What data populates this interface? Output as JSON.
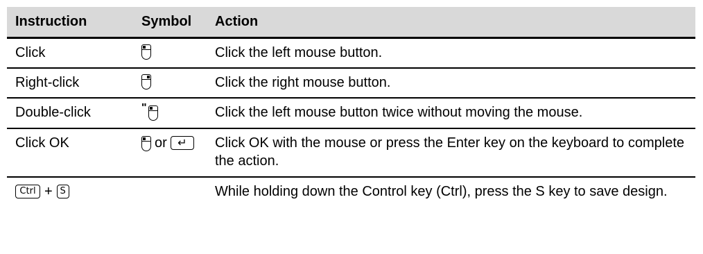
{
  "table": {
    "headers": {
      "instruction": "Instruction",
      "symbol": "Symbol",
      "action": "Action"
    },
    "rows": [
      {
        "instruction": "Click",
        "symbol_icon": "mouse-left-icon",
        "action": "Click the left mouse button."
      },
      {
        "instruction": "Right-click",
        "symbol_icon": "mouse-right-icon",
        "action": "Click the right mouse button."
      },
      {
        "instruction": "Double-click",
        "symbol_icon": "mouse-double-click-icon",
        "symbol_mark": "\"",
        "action": "Click the left mouse button twice without moving the mouse."
      },
      {
        "instruction": "Click OK",
        "symbol_icon": "mouse-left-icon",
        "symbol_or": "or",
        "symbol_key": "↵",
        "symbol_key_icon": "enter-key-icon",
        "action": "Click OK with the mouse or press the Enter key on the keyboard to complete the action."
      },
      {
        "instruction_keys": [
          "Ctrl",
          "S"
        ],
        "instruction_plus": "+",
        "action": "While holding down the Control key (Ctrl), press the S key to save design."
      }
    ]
  },
  "colors": {
    "header_background": "#d9d9d9",
    "rule": "#000000"
  }
}
